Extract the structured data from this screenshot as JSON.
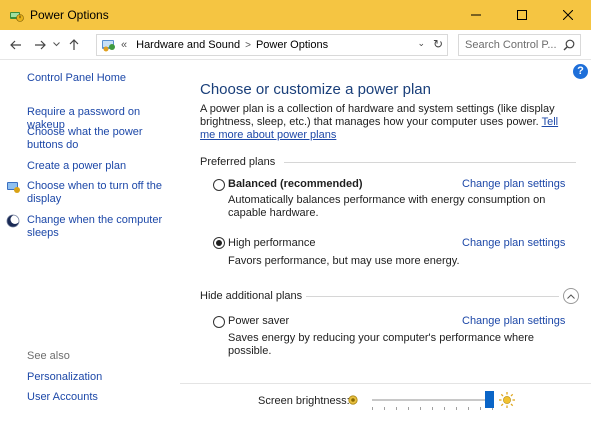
{
  "window": {
    "title": "Power Options"
  },
  "address_bar": {
    "overflow": "«",
    "crumbs": [
      "Hardware and Sound",
      "Power Options"
    ],
    "search_placeholder": "Search Control P..."
  },
  "left_pane": {
    "home_link": "Control Panel Home",
    "links": [
      "Require a password on wakeup",
      "Choose what the power buttons do",
      "Create a power plan",
      "Choose when to turn off the display",
      "Change when the computer sleeps"
    ],
    "see_also_label": "See also",
    "see_also_links": [
      "Personalization",
      "User Accounts"
    ]
  },
  "main": {
    "heading": "Choose or customize a power plan",
    "intro_text": "A power plan is a collection of hardware and system settings (like display brightness, sleep, etc.) that manages how your computer uses power. ",
    "intro_link": "Tell me more about power plans",
    "preferred_header": "Preferred plans",
    "hidden_header": "Hide additional plans",
    "change_label": "Change plan settings",
    "plans": [
      {
        "name": "Balanced (recommended)",
        "description": "Automatically balances performance with energy consumption on capable hardware.",
        "selected": false
      },
      {
        "name": "High performance",
        "description": "Favors performance, but may use more energy.",
        "selected": true
      },
      {
        "name": "Power saver",
        "description": "Saves energy by reducing your computer's performance where possible.",
        "selected": false
      }
    ],
    "brightness_label": "Screen brightness:",
    "brightness_level": 1.0
  },
  "colors": {
    "titlebar": "#f5c542",
    "link": "#1d48a8",
    "heading": "#1a3f7a",
    "slider_thumb": "#0a65c7",
    "help": "#1e6fd9"
  },
  "icons": [
    "power-options-app-icon",
    "back-arrow-icon",
    "forward-arrow-icon",
    "recent-locations-icon",
    "up-arrow-icon",
    "control-panel-icon",
    "chevron-down-icon",
    "refresh-icon",
    "search-icon",
    "minimize-icon",
    "maximize-icon",
    "close-icon",
    "display-power-icon",
    "moon-sleep-icon",
    "help-icon",
    "collapse-up-icon",
    "sun-dim-icon",
    "sun-bright-icon"
  ]
}
